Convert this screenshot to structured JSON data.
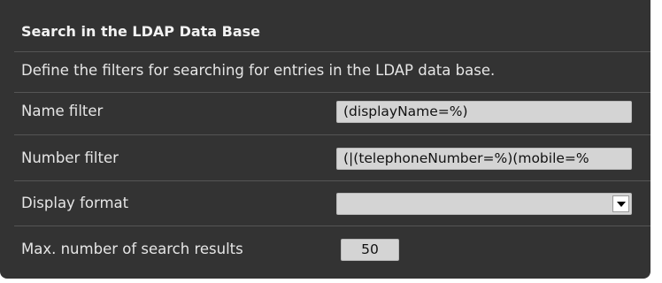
{
  "section": {
    "title": "Search in the LDAP Data Base",
    "description": "Define the filters for searching for entries in the LDAP data base."
  },
  "fields": {
    "name_filter": {
      "label": "Name filter",
      "value": "(displayName=%)"
    },
    "number_filter": {
      "label": "Number filter",
      "value": "(|(telephoneNumber=%)(mobile=%"
    },
    "display_format": {
      "label": "Display format",
      "value": "",
      "icon": "chevron-down-icon"
    },
    "max_results": {
      "label": "Max. number of search results",
      "value": "50"
    }
  },
  "colors": {
    "panel_background": "#333333",
    "field_background": "#d4d4d4",
    "text": "#e6e6e6"
  }
}
